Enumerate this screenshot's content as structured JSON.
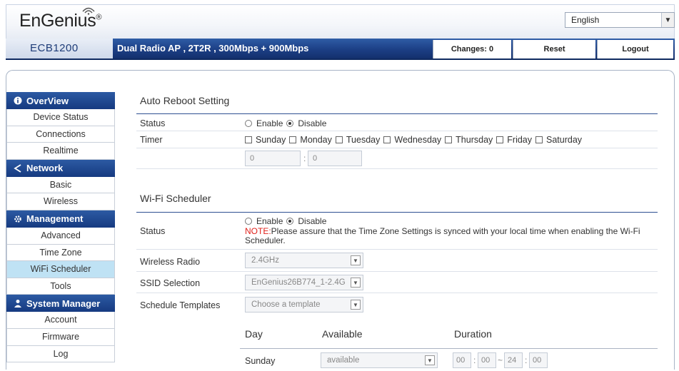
{
  "header": {
    "logo_text": "EnGenius",
    "logo_reg": "®",
    "language": "English",
    "model": "ECB1200",
    "description": "Dual Radio AP , 2T2R , 300Mbps + 900Mbps",
    "changes_label": "Changes: 0",
    "reset_label": "Reset",
    "logout_label": "Logout"
  },
  "sidebar": {
    "sections": [
      {
        "title": "OverView",
        "icon": "info-icon",
        "items": [
          "Device Status",
          "Connections",
          "Realtime"
        ]
      },
      {
        "title": "Network",
        "icon": "share-icon",
        "items": [
          "Basic",
          "Wireless"
        ]
      },
      {
        "title": "Management",
        "icon": "gear-icon",
        "items": [
          "Advanced",
          "Time Zone",
          "WiFi Scheduler",
          "Tools"
        ]
      },
      {
        "title": "System Manager",
        "icon": "user-icon",
        "items": [
          "Account",
          "Firmware",
          "Log"
        ]
      }
    ],
    "active_item": "WiFi Scheduler"
  },
  "auto_reboot": {
    "title": "Auto Reboot Setting",
    "status_label": "Status",
    "enable_label": "Enable",
    "disable_label": "Disable",
    "status_value": "Disable",
    "timer_label": "Timer",
    "days": [
      "Sunday",
      "Monday",
      "Tuesday",
      "Wednesday",
      "Thursday",
      "Friday",
      "Saturday"
    ],
    "hour": "0",
    "minute": "0",
    "separator": ":"
  },
  "wifi_scheduler": {
    "title": "Wi-Fi Scheduler",
    "status_label": "Status",
    "enable_label": "Enable",
    "disable_label": "Disable",
    "status_value": "Disable",
    "note_prefix": "NOTE:",
    "note_text": "Please assure that the Time Zone Settings is synced with your local time when enabling the Wi-Fi Scheduler.",
    "wireless_radio_label": "Wireless Radio",
    "wireless_radio_value": "2.4GHz",
    "ssid_label": "SSID Selection",
    "ssid_value": "EnGenius26B774_1-2.4G",
    "templates_label": "Schedule Templates",
    "templates_placeholder": "Choose a template",
    "table": {
      "col_day": "Day",
      "col_available": "Available",
      "col_duration": "Duration",
      "rows": [
        {
          "day": "Sunday",
          "available": "available",
          "start_h": "00",
          "start_m": "00",
          "tilde": "~",
          "end_h": "24",
          "end_m": "00"
        }
      ]
    }
  }
}
